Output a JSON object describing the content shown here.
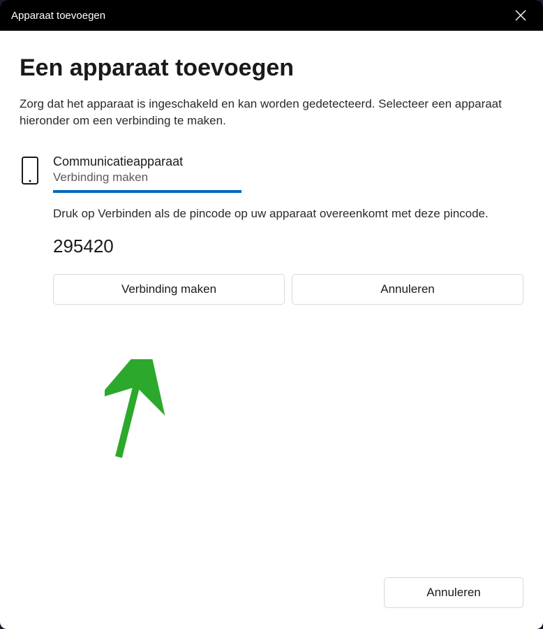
{
  "titlebar": {
    "title": "Apparaat toevoegen"
  },
  "heading": "Een apparaat toevoegen",
  "subtext": "Zorg dat het apparaat is ingeschakeld en kan worden gedetecteerd. Selecteer een apparaat hieronder om een verbinding te maken.",
  "device": {
    "name": "Communicatieapparaat",
    "status": "Verbinding maken",
    "pin_instruction": "Druk op Verbinden als de pincode op uw apparaat overeenkomt met deze pincode.",
    "pincode": "295420",
    "connect_label": "Verbinding maken",
    "cancel_label": "Annuleren"
  },
  "footer": {
    "cancel_label": "Annuleren"
  },
  "colors": {
    "accent": "#0067c0",
    "arrow": "#2ca82c"
  }
}
